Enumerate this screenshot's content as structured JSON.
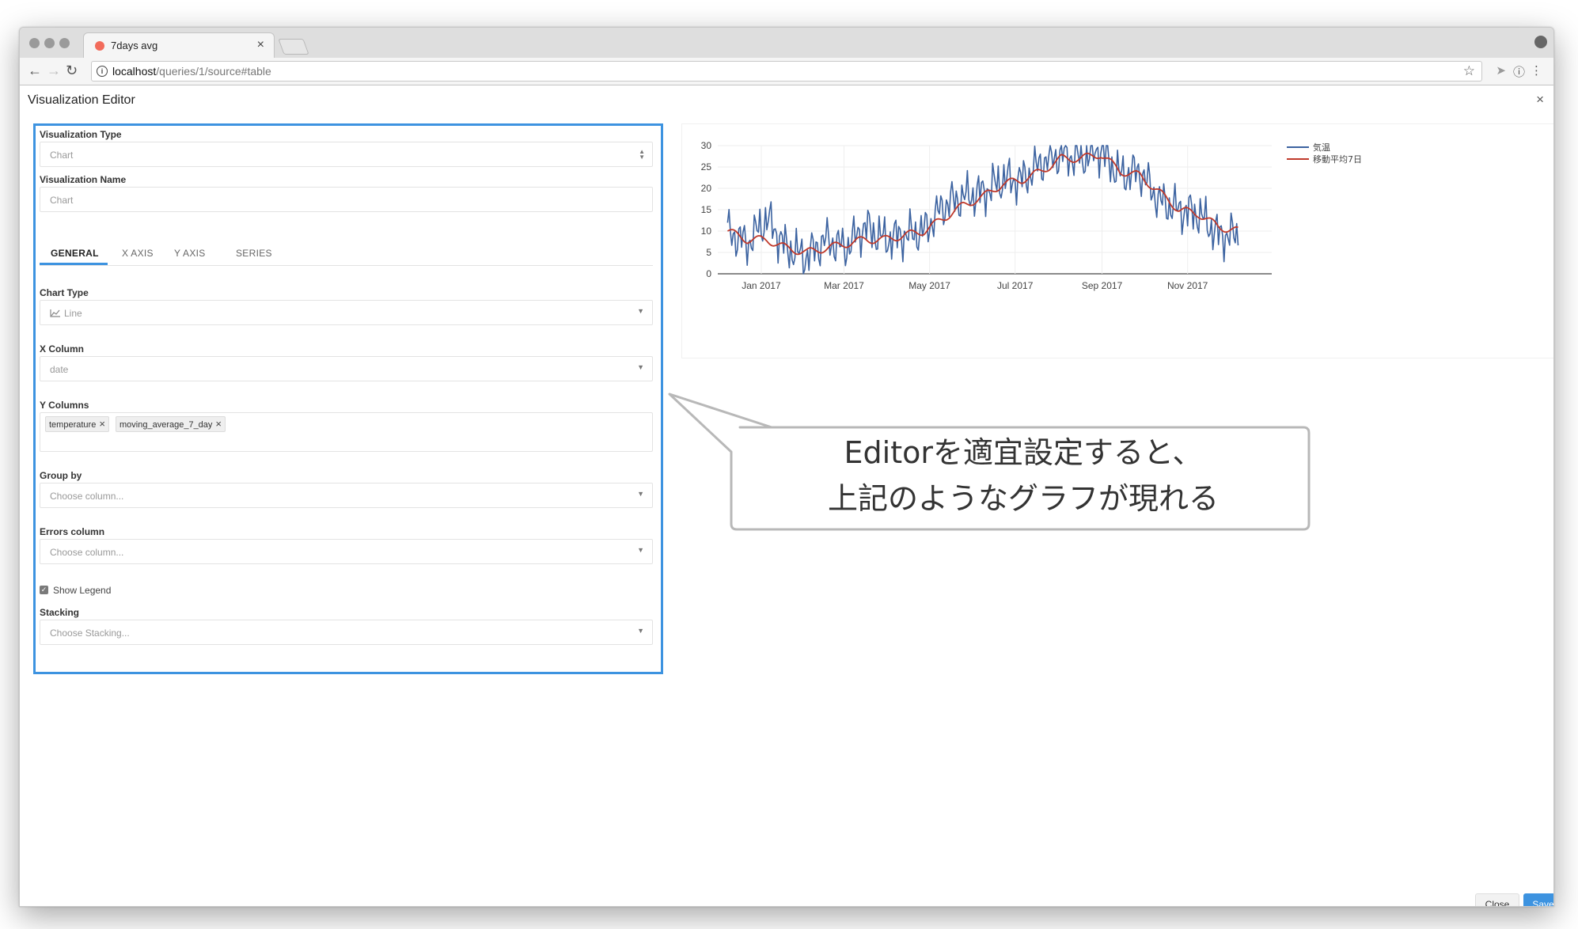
{
  "browser": {
    "tab_title": "7days avg",
    "url_host": "localhost",
    "url_path": "/queries/1/source#table"
  },
  "modal": {
    "title": "Visualization Editor",
    "close_label": "Close",
    "save_label": "Save",
    "close_glyph": "×"
  },
  "editor": {
    "visualization_type": {
      "label": "Visualization Type",
      "value": "Chart"
    },
    "visualization_name": {
      "label": "Visualization Name",
      "value": "Chart"
    },
    "tabs": [
      {
        "label": "GENERAL",
        "active": true
      },
      {
        "label": "X AXIS",
        "active": false
      },
      {
        "label": "Y AXIS",
        "active": false
      },
      {
        "label": "SERIES",
        "active": false
      }
    ],
    "chart_type": {
      "label": "Chart Type",
      "value": "Line",
      "icon": "line-chart-icon"
    },
    "x_column": {
      "label": "X Column",
      "value": "date"
    },
    "y_columns": {
      "label": "Y Columns",
      "values": [
        "temperature",
        "moving_average_7_day"
      ]
    },
    "group_by": {
      "label": "Group by",
      "placeholder": "Choose column..."
    },
    "errors_column": {
      "label": "Errors column",
      "placeholder": "Choose column..."
    },
    "show_legend": {
      "label": "Show Legend",
      "checked": true
    },
    "stacking": {
      "label": "Stacking",
      "placeholder": "Choose Stacking..."
    }
  },
  "callout": {
    "line1": "Editorを適宜設定すると、",
    "line2": "上記のようなグラフが現れる"
  },
  "colors": {
    "accent": "#3d93e0",
    "series_temperature": "#3b62a0",
    "series_moving_average": "#c0392b"
  },
  "chart_data": {
    "type": "line",
    "xlabel": "",
    "ylabel": "",
    "x_range": [
      "2016-12-01",
      "2017-12-31"
    ],
    "ylim": [
      0,
      30
    ],
    "y_ticks": [
      0,
      5,
      10,
      15,
      20,
      25,
      30
    ],
    "x_ticks": [
      "Jan 2017",
      "Mar 2017",
      "May 2017",
      "Jul 2017",
      "Sep 2017",
      "Nov 2017"
    ],
    "x_tick_dates": [
      "2017-01-01",
      "2017-03-01",
      "2017-05-01",
      "2017-07-01",
      "2017-09-01",
      "2017-11-01"
    ],
    "grid": true,
    "legend_position": "top-right",
    "x_anchor_dates": [
      "2016-12-08",
      "2016-12-22",
      "2017-01-05",
      "2017-01-19",
      "2017-02-02",
      "2017-02-16",
      "2017-03-02",
      "2017-03-16",
      "2017-03-30",
      "2017-04-13",
      "2017-04-27",
      "2017-05-11",
      "2017-05-25",
      "2017-06-08",
      "2017-06-22",
      "2017-07-06",
      "2017-07-20",
      "2017-08-03",
      "2017-08-17",
      "2017-08-31",
      "2017-09-14",
      "2017-09-28",
      "2017-10-12",
      "2017-10-26",
      "2017-11-09",
      "2017-11-23",
      "2017-12-07"
    ],
    "series": [
      {
        "name": "気温",
        "color": "#3b62a0",
        "values": [
          10,
          7,
          13,
          6,
          4,
          8,
          6,
          11,
          8,
          9,
          10,
          16,
          18,
          19,
          22,
          22,
          26,
          28,
          27,
          29,
          23,
          24,
          17,
          15,
          14,
          9,
          9
        ]
      },
      {
        "name": "移動平均7日",
        "color": "#c0392b",
        "values": [
          10,
          8,
          8,
          6,
          5,
          6,
          7,
          8,
          8,
          9,
          10,
          13,
          16,
          18,
          21,
          22,
          24,
          27,
          27,
          28,
          24,
          23,
          19,
          15,
          14,
          11,
          10
        ]
      }
    ]
  }
}
